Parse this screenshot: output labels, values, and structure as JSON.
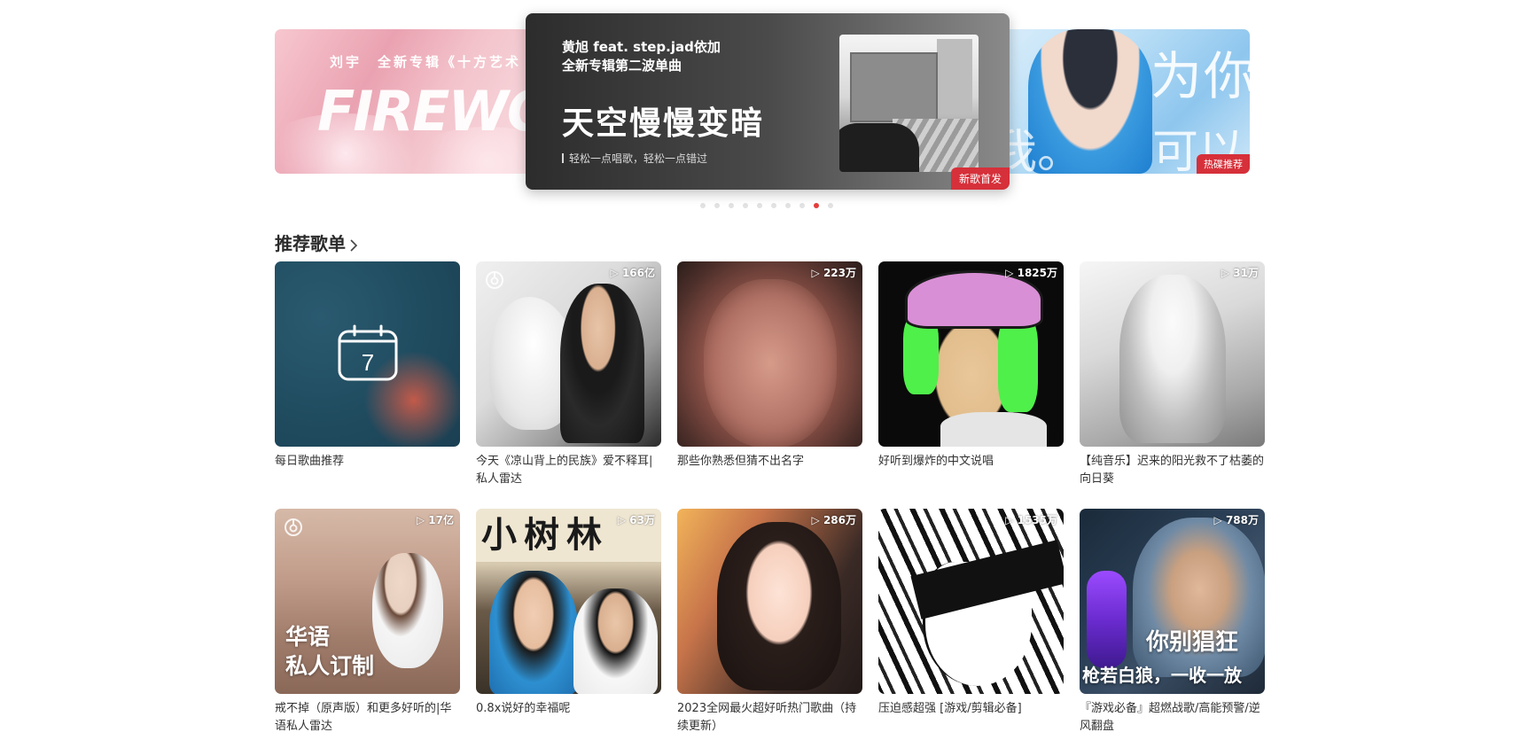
{
  "banners": {
    "left": {
      "top_text": "刘宇　全新专辑《十方艺术",
      "big_text": "FIREWORK"
    },
    "center": {
      "line1": "黄旭 feat. step.jad依加",
      "line2": "全新专辑第二波单曲",
      "title": "天空慢慢变暗",
      "subtitle": "轻松一点唱歌，轻松一点错过",
      "tag": "新歌首发"
    },
    "right": {
      "text1": "为你",
      "text2": "我。",
      "text3": "可以",
      "tag": "热碟推荐"
    },
    "dots_count": 10,
    "active_dot": 8
  },
  "section": {
    "title": "推荐歌单"
  },
  "playlists": [
    {
      "title": "每日歌曲推荐",
      "count": "",
      "calendar_day": "7",
      "cover": "daily"
    },
    {
      "title": "今天《凉山背上的民族》爱不释耳|私人雷达",
      "count": "166亿",
      "cover": "dog"
    },
    {
      "title": "那些你熟悉但猜不出名字",
      "count": "223万",
      "cover": "face"
    },
    {
      "title": "好听到爆炸的中文说唱",
      "count": "1825万",
      "cover": "anime1"
    },
    {
      "title": "【纯音乐】迟来的阳光救不了枯萎的向日葵",
      "count": "31万",
      "cover": "sketch"
    },
    {
      "title": "戒不掉（原声版）和更多好听的|华语私人雷达",
      "count": "17亿",
      "cover": "rock",
      "cover_text1": "华语",
      "cover_text2": "私人订制"
    },
    {
      "title": "0.8x说好的幸福呢",
      "count": "63万",
      "cover": "couple",
      "cover_text": "小树林"
    },
    {
      "title": "2023全网最火超好听热门歌曲（持续更新）",
      "count": "286万",
      "cover": "selfie"
    },
    {
      "title": "压迫感超强 [游戏/剪辑必备]",
      "count": "1535万",
      "cover": "manga"
    },
    {
      "title": "『游戏必备』超燃战歌/高能预警/逆风翻盘",
      "count": "788万",
      "cover": "game",
      "cover_text1": "你别猖狂",
      "cover_text2": "枪若白狼，一收一放"
    }
  ],
  "colors": {
    "accent": "#e33e3e",
    "tag_red": "#d6303a",
    "title_text": "#2b2b2b",
    "card_text": "#333333"
  },
  "icons": {
    "play": "play-triangle-icon",
    "chevron": "chevron-right-icon",
    "calendar": "calendar-icon",
    "netease": "netease-logo-icon"
  }
}
